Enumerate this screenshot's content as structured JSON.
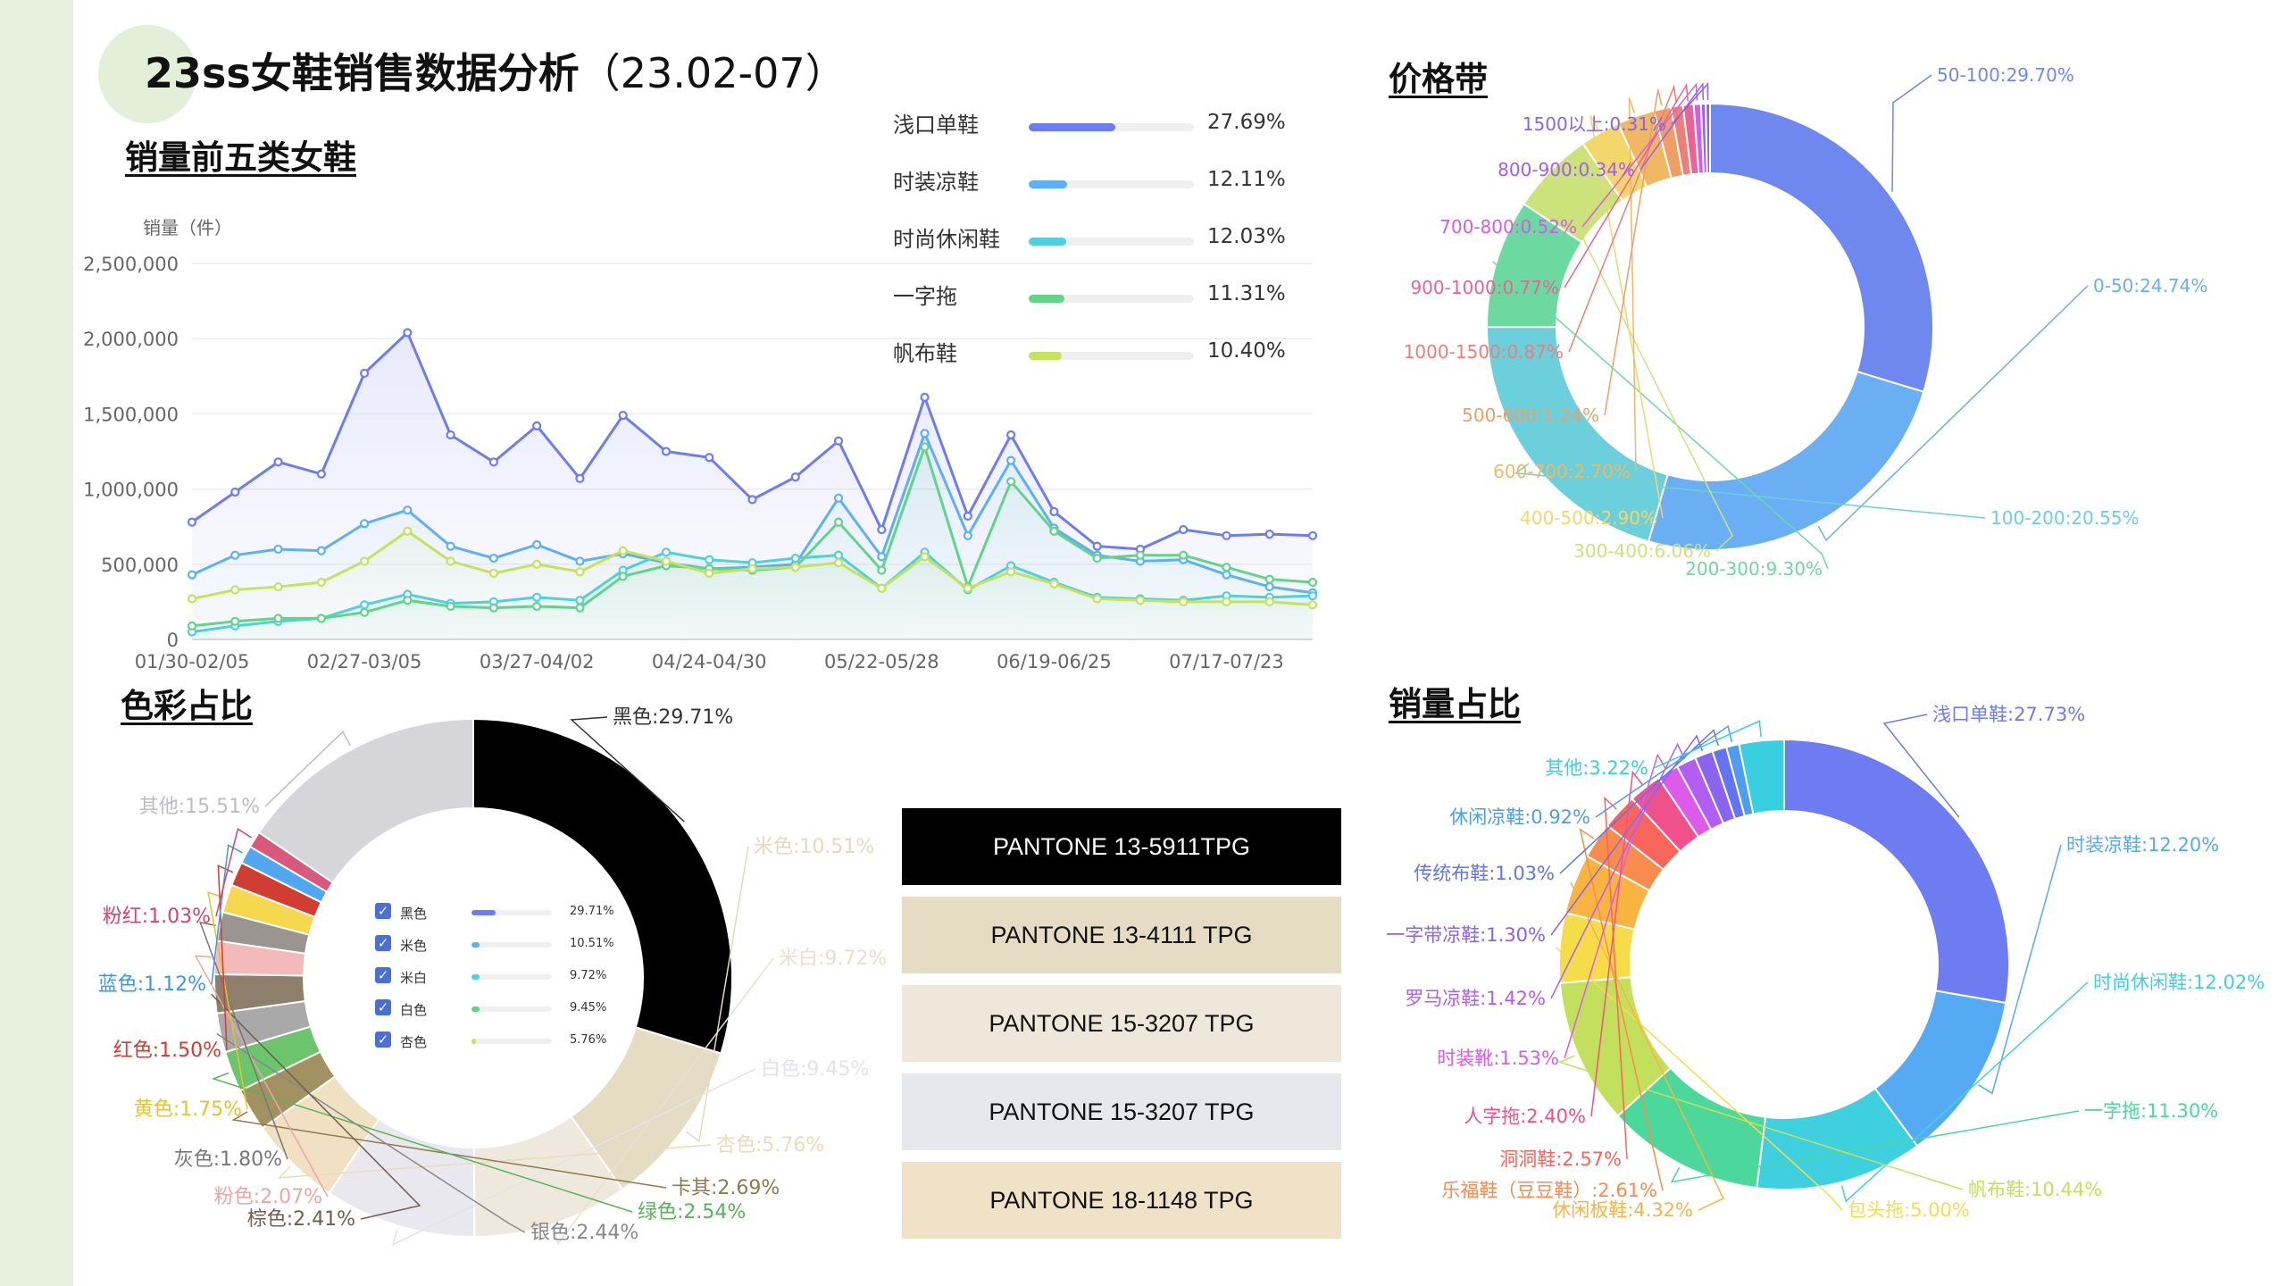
{
  "page": {
    "title": "23ss女鞋销售数据分析",
    "title_period": "（23.02-07）"
  },
  "sections": {
    "top5": "销量前五类女鞋",
    "price": "价格带",
    "color": "色彩占比",
    "sales": "销量占比"
  },
  "colors": {
    "series": [
      "#6d7cf0",
      "#5eb0f5",
      "#4fd0dc",
      "#62d48a",
      "#c6e25a"
    ]
  },
  "chart_data": [
    {
      "type": "line",
      "title": "",
      "ylabel": "销量（件）",
      "ylim": [
        0,
        2500000
      ],
      "yticks": [
        "2,500,000",
        "2,000,000",
        "1,500,000",
        "1,000,000",
        "500,000",
        "0"
      ],
      "yticks_values": [
        2500000,
        2000000,
        1500000,
        1000000,
        500000,
        0
      ],
      "x_count": 27,
      "x_tick_labels": [
        {
          "index": 0,
          "label": "01/30-02/05"
        },
        {
          "index": 4,
          "label": "02/27-03/05"
        },
        {
          "index": 8,
          "label": "03/27-04/02"
        },
        {
          "index": 12,
          "label": "04/24-04/30"
        },
        {
          "index": 16,
          "label": "05/22-05/28"
        },
        {
          "index": 20,
          "label": "06/19-06/25"
        },
        {
          "index": 24,
          "label": "07/17-07/23"
        }
      ],
      "grid": true,
      "series": [
        {
          "name": "浅口单鞋",
          "values": [
            780000,
            980000,
            1180000,
            1100000,
            1770000,
            2040000,
            1360000,
            1180000,
            1420000,
            1070000,
            1490000,
            1250000,
            1210000,
            930000,
            1080000,
            1320000,
            730000,
            1610000,
            820000,
            1360000,
            850000,
            620000,
            600000,
            730000,
            690000,
            700000,
            690000
          ]
        },
        {
          "name": "时装凉鞋",
          "values": [
            430000,
            560000,
            600000,
            590000,
            770000,
            860000,
            620000,
            540000,
            630000,
            520000,
            570000,
            510000,
            470000,
            480000,
            500000,
            940000,
            550000,
            1370000,
            690000,
            1190000,
            740000,
            560000,
            520000,
            530000,
            430000,
            350000,
            310000
          ]
        },
        {
          "name": "时尚休闲鞋",
          "values": [
            50000,
            90000,
            120000,
            140000,
            230000,
            300000,
            240000,
            250000,
            280000,
            260000,
            460000,
            580000,
            530000,
            510000,
            540000,
            560000,
            340000,
            580000,
            330000,
            490000,
            380000,
            280000,
            270000,
            260000,
            290000,
            280000,
            290000
          ]
        },
        {
          "name": "一字拖",
          "values": [
            90000,
            120000,
            140000,
            140000,
            180000,
            260000,
            220000,
            210000,
            220000,
            210000,
            420000,
            490000,
            470000,
            460000,
            480000,
            780000,
            460000,
            1280000,
            350000,
            1050000,
            720000,
            540000,
            560000,
            560000,
            480000,
            400000,
            380000
          ]
        },
        {
          "name": "帆布鞋",
          "values": [
            270000,
            330000,
            350000,
            380000,
            520000,
            720000,
            520000,
            440000,
            500000,
            450000,
            590000,
            520000,
            440000,
            470000,
            480000,
            510000,
            340000,
            550000,
            340000,
            450000,
            370000,
            270000,
            260000,
            250000,
            250000,
            250000,
            230000
          ]
        }
      ],
      "legend": [
        {
          "name": "浅口单鞋",
          "value": "27.69%",
          "fraction": 0.2769
        },
        {
          "name": "时装凉鞋",
          "value": "12.11%",
          "fraction": 0.1211
        },
        {
          "name": "时尚休闲鞋",
          "value": "12.03%",
          "fraction": 0.1203
        },
        {
          "name": "一字拖",
          "value": "11.31%",
          "fraction": 0.1131
        },
        {
          "name": "帆布鞋",
          "value": "10.40%",
          "fraction": 0.104
        }
      ]
    },
    {
      "type": "pie",
      "name": "价格带",
      "donut": true,
      "slices": [
        {
          "label": "50-100:29.70%",
          "value": 29.7,
          "color": "#6f88f0"
        },
        {
          "label": "0-50:24.74%",
          "value": 24.74,
          "color": "#6aaef3"
        },
        {
          "label": "100-200:20.55%",
          "value": 20.55,
          "color": "#6ccfdc"
        },
        {
          "label": "200-300:9.30%",
          "value": 9.3,
          "color": "#6cd9a0"
        },
        {
          "label": "300-400:6.06%",
          "value": 6.06,
          "color": "#cbe37a"
        },
        {
          "label": "400-500:2.90%",
          "value": 2.9,
          "color": "#f3d76a"
        },
        {
          "label": "600-700:2.70%",
          "value": 2.7,
          "color": "#f1b863"
        },
        {
          "label": "500-600:1.24%",
          "value": 1.24,
          "color": "#ef9f66"
        },
        {
          "label": "1000-1500:0.87%",
          "value": 0.87,
          "color": "#ec7f77"
        },
        {
          "label": "900-1000:0.77%",
          "value": 0.77,
          "color": "#e96394"
        },
        {
          "label": "700-800:0.52%",
          "value": 0.52,
          "color": "#d25ee6"
        },
        {
          "label": "800-900:0.34%",
          "value": 0.34,
          "color": "#a05ef0"
        },
        {
          "label": "1500以上:0.31%",
          "value": 0.31,
          "color": "#8266ee"
        }
      ]
    },
    {
      "type": "pie",
      "name": "色彩占比",
      "donut": true,
      "slices": [
        {
          "label": "黑色:29.71%",
          "value": 29.71,
          "color": "#000000",
          "label_color": "#333333"
        },
        {
          "label": "米色:10.51%",
          "value": 10.51,
          "color": "#e6dcc4",
          "label_color": "#e3d9bf"
        },
        {
          "label": "米白:9.72%",
          "value": 9.72,
          "color": "#efe8dc",
          "label_color": "#e8dfd1"
        },
        {
          "label": "白色:9.45%",
          "value": 9.45,
          "color": "#e8e8ee",
          "label_color": "#e3e3ea"
        },
        {
          "label": "杏色:5.76%",
          "value": 5.76,
          "color": "#f0e1c2",
          "label_color": "#ecdbb9"
        },
        {
          "label": "卡其:2.69%",
          "value": 2.69,
          "color": "#a39261",
          "label_color": "#8e7b4a"
        },
        {
          "label": "绿色:2.54%",
          "value": 2.54,
          "color": "#6cc46c",
          "label_color": "#56b656"
        },
        {
          "label": "银色:2.44%",
          "value": 2.44,
          "color": "#a9a9a9",
          "label_color": "#888888"
        },
        {
          "label": "棕色:2.41%",
          "value": 2.41,
          "color": "#8e7e6c",
          "label_color": "#6e5f50"
        },
        {
          "label": "粉色:2.07%",
          "value": 2.07,
          "color": "#f4b9b9",
          "label_color": "#eba6a6"
        },
        {
          "label": "灰色:1.80%",
          "value": 1.8,
          "color": "#9a9590",
          "label_color": "#777777"
        },
        {
          "label": "黄色:1.75%",
          "value": 1.75,
          "color": "#f6d84e",
          "label_color": "#e5c32a"
        },
        {
          "label": "红色:1.50%",
          "value": 1.5,
          "color": "#d23d33",
          "label_color": "#d23d33"
        },
        {
          "label": "蓝色:1.12%",
          "value": 1.12,
          "color": "#4fa7ef",
          "label_color": "#3f98e0"
        },
        {
          "label": "粉红:1.03%",
          "value": 1.03,
          "color": "#d8587e",
          "label_color": "#d0466e"
        },
        {
          "label": "其他:15.51%",
          "value": 15.51,
          "color": "#d6d6da",
          "label_color": "#bcbcc2"
        }
      ],
      "inner_legend": [
        {
          "name": "黑色",
          "value": "29.71%",
          "fraction": 0.2971
        },
        {
          "name": "米色",
          "value": "10.51%",
          "fraction": 0.1051
        },
        {
          "name": "米白",
          "value": "9.72%",
          "fraction": 0.0972
        },
        {
          "name": "白色",
          "value": "9.45%",
          "fraction": 0.0945
        },
        {
          "name": "杏色",
          "value": "5.76%",
          "fraction": 0.0576
        }
      ]
    },
    {
      "type": "pie",
      "name": "销量占比",
      "donut": true,
      "slices": [
        {
          "label": "浅口单鞋:27.73%",
          "value": 27.73,
          "color": "#6d7cf0"
        },
        {
          "label": "时装凉鞋:12.20%",
          "value": 12.2,
          "color": "#56aaf4"
        },
        {
          "label": "时尚休闲鞋:12.02%",
          "value": 12.02,
          "color": "#3fd0e0"
        },
        {
          "label": "一字拖:11.30%",
          "value": 11.3,
          "color": "#4bd89a"
        },
        {
          "label": "帆布鞋:10.44%",
          "value": 10.44,
          "color": "#c3e05c"
        },
        {
          "label": "包头拖:5.00%",
          "value": 5.0,
          "color": "#f7dc4a"
        },
        {
          "label": "休闲板鞋:4.32%",
          "value": 4.32,
          "color": "#f7b441"
        },
        {
          "label": "乐福鞋（豆豆鞋）:2.61%",
          "value": 2.61,
          "color": "#f88c4c"
        },
        {
          "label": "洞洞鞋:2.57%",
          "value": 2.57,
          "color": "#f8665b"
        },
        {
          "label": "人字拖:2.40%",
          "value": 2.4,
          "color": "#f0508c"
        },
        {
          "label": "时装靴:1.53%",
          "value": 1.53,
          "color": "#dc5be8"
        },
        {
          "label": "罗马凉鞋:1.42%",
          "value": 1.42,
          "color": "#b35ef2"
        },
        {
          "label": "一字带凉鞋:1.30%",
          "value": 1.3,
          "color": "#8a63ef"
        },
        {
          "label": "传统布鞋:1.03%",
          "value": 1.03,
          "color": "#6274ee"
        },
        {
          "label": "休闲凉鞋:0.92%",
          "value": 0.92,
          "color": "#4d9df2"
        },
        {
          "label": "其他:3.22%",
          "value": 3.22,
          "color": "#38cfe0"
        }
      ]
    }
  ],
  "pantone": [
    {
      "label": "PANTONE 13-5911TPG",
      "bg": "#000000",
      "fg": "#ffffff"
    },
    {
      "label": "PANTONE 13-4111 TPG",
      "bg": "#e6dcc4",
      "fg": "#111111"
    },
    {
      "label": "PANTONE 15-3207 TPG",
      "bg": "#efe7da",
      "fg": "#111111"
    },
    {
      "label": "PANTONE 15-3207 TPG",
      "bg": "#e7e8ee",
      "fg": "#111111"
    },
    {
      "label": "PANTONE 18-1148 TPG",
      "bg": "#efe2c6",
      "fg": "#111111"
    }
  ]
}
